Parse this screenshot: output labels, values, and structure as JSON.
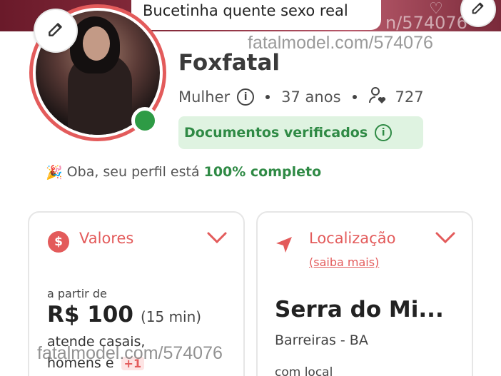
{
  "cover": {
    "logo_glyph": "♡",
    "watermark": "n/574076"
  },
  "header": {
    "bio_chip": "Bucetinha quente sexo real",
    "edit_icon": "pencil-icon"
  },
  "watermark": {
    "top": "fatalmodel.com/574076",
    "bottom": "fatalmodel.com/574076"
  },
  "profile": {
    "name": "Foxfatal",
    "gender": "Mulher",
    "age": "37 anos",
    "followers": "727",
    "verified_label": "Documentos verificados",
    "online": true,
    "online_color": "#2e9b45"
  },
  "completeness": {
    "emoji": "🎉",
    "prefix": "Oba, seu perfil está",
    "percent_text": "100% completo"
  },
  "cards": {
    "valores": {
      "title": "Valores",
      "icon": "dollar-icon",
      "icon_glyph": "$",
      "price_prefix": "a partir de",
      "price": "R$ 100",
      "duration": "(15 min)",
      "service_line1": "atende casais,",
      "service_line2": "homens e",
      "more_badge": "+1"
    },
    "localizacao": {
      "title": "Localização",
      "icon": "navigation-arrow-icon",
      "link": "(saiba mais)",
      "city": "Serra do Mi...",
      "region": "Barreiras - BA",
      "attend_prefix": "com local"
    }
  },
  "colors": {
    "accent": "#e35b5b",
    "success": "#2f8a45",
    "success_bg": "#dff3e1"
  }
}
